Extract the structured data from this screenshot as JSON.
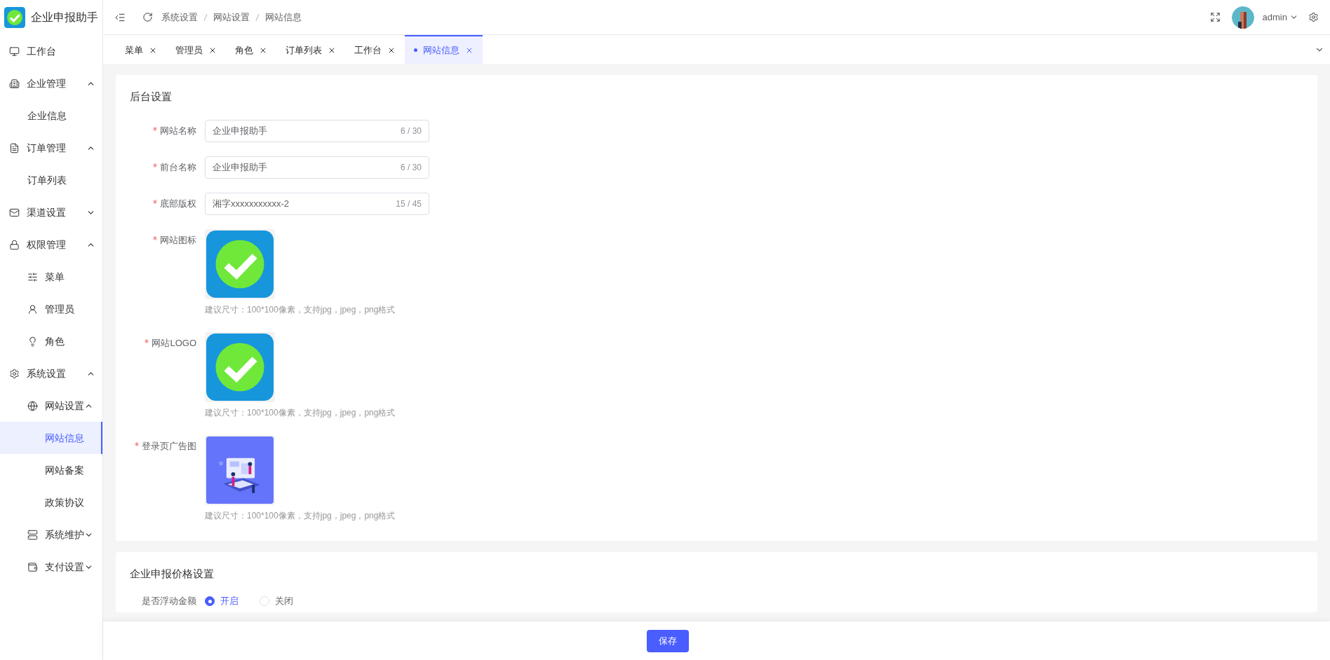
{
  "app": {
    "title": "企业申报助手"
  },
  "sidebar": {
    "items": [
      {
        "label": "工作台",
        "selected": false
      },
      {
        "label": "企业管理",
        "selected": false,
        "expanded": true,
        "children": [
          {
            "label": "企业信息",
            "selected": false
          }
        ]
      },
      {
        "label": "订单管理",
        "selected": false,
        "expanded": true,
        "children": [
          {
            "label": "订单列表",
            "selected": false
          }
        ]
      },
      {
        "label": "渠道设置",
        "selected": false,
        "expanded": false
      },
      {
        "label": "权限管理",
        "selected": false,
        "expanded": true,
        "children": [
          {
            "label": "菜单",
            "selected": false
          },
          {
            "label": "管理员",
            "selected": false
          },
          {
            "label": "角色",
            "selected": false
          }
        ]
      },
      {
        "label": "系统设置",
        "selected": false,
        "expanded": true,
        "children": [
          {
            "label": "网站设置",
            "selected": false,
            "expanded": true,
            "children": [
              {
                "label": "网站信息",
                "selected": true
              },
              {
                "label": "网站备案",
                "selected": false
              },
              {
                "label": "政策协议",
                "selected": false
              }
            ]
          },
          {
            "label": "系统维护",
            "selected": false,
            "expanded": false
          },
          {
            "label": "支付设置",
            "selected": false,
            "expanded": false
          }
        ]
      }
    ]
  },
  "header": {
    "breadcrumb": [
      "系统设置",
      "网站设置",
      "网站信息"
    ],
    "user": "admin"
  },
  "tabs": [
    {
      "label": "菜单",
      "selected": false
    },
    {
      "label": "管理员",
      "selected": false
    },
    {
      "label": "角色",
      "selected": false
    },
    {
      "label": "订单列表",
      "selected": false
    },
    {
      "label": "工作台",
      "selected": false
    },
    {
      "label": "网站信息",
      "selected": true
    }
  ],
  "sections": [
    {
      "title": "后台设置",
      "fields": [
        {
          "kind": "input",
          "label": "网站名称",
          "required": true,
          "value": "企业申报助手",
          "count": "6 / 30"
        },
        {
          "kind": "input",
          "label": "前台名称",
          "required": true,
          "value": "企业申报助手",
          "count": "6 / 30"
        },
        {
          "kind": "input",
          "label": "底部版权",
          "required": true,
          "value": "湘字xxxxxxxxxxx-2",
          "count": "15 / 45"
        },
        {
          "label": "网站图标",
          "required": true,
          "image": {
            "kind": "logo"
          },
          "hint": "建议尺寸：100*100像素，支持jpg，jpeg，png格式"
        },
        {
          "label": "网站LOGO",
          "required": true,
          "image": {
            "kind": "logo"
          },
          "hint": "建议尺寸：100*100像素，支持jpg，jpeg，png格式"
        },
        {
          "label": "登录页广告图",
          "required": true,
          "hint": "建议尺寸：100*100像素，支持jpg，jpeg，png格式"
        }
      ]
    },
    {
      "title": "企业申报价格设置",
      "fields": [
        {
          "kind": "radio",
          "label": "是否浮动金额",
          "options": [
            {
              "label": "开启",
              "selected": true
            },
            {
              "label": "关闭",
              "selected": false
            }
          ]
        }
      ]
    }
  ],
  "footer": {
    "save": "保存"
  }
}
